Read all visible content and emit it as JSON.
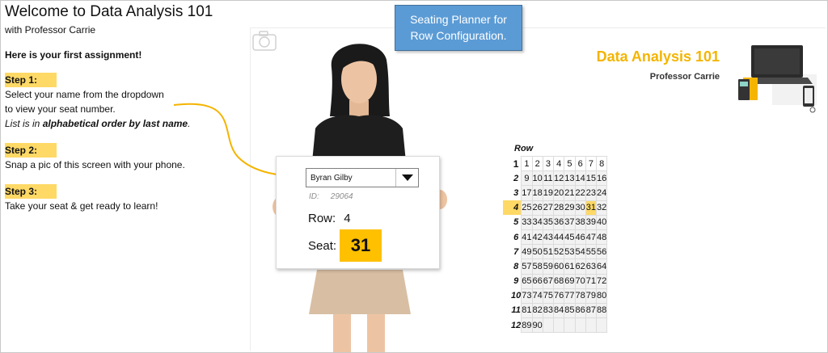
{
  "left": {
    "title": "Welcome to Data Analysis 101",
    "subtitle": "with Professor Carrie",
    "intro": "Here is your first assignment!",
    "steps": [
      {
        "label": "Step 1:",
        "lines": [
          "Select your name from the dropdown",
          "to view your seat number."
        ],
        "note_prefix": "List is in ",
        "note_bold": "alphabetical order by last name",
        "note_suffix": "."
      },
      {
        "label": "Step 2:",
        "lines": [
          "Snap a pic of this screen with your phone."
        ]
      },
      {
        "label": "Step 3:",
        "lines": [
          "Take your seat & get ready to learn!"
        ]
      }
    ]
  },
  "callout": {
    "line1": "Seating Planner for",
    "line2": "Row Configuration."
  },
  "brand": {
    "title": "Data Analysis 101",
    "subtitle": "Professor Carrie"
  },
  "sign": {
    "selected_student": "Byran Gilby",
    "id_label": "ID:",
    "id_value": "29064",
    "row_label": "Row:",
    "row_value": "4",
    "seat_label": "Seat:",
    "seat_value": "31"
  },
  "grid": {
    "row_header": "Row",
    "columns": [
      "1",
      "2",
      "3",
      "4",
      "5",
      "6",
      "7",
      "8"
    ],
    "rows": [
      {
        "row": "2",
        "seats": [
          "9",
          "10",
          "11",
          "12",
          "13",
          "14",
          "15",
          "16"
        ]
      },
      {
        "row": "3",
        "seats": [
          "17",
          "18",
          "19",
          "20",
          "21",
          "22",
          "23",
          "24"
        ]
      },
      {
        "row": "4",
        "seats": [
          "25",
          "26",
          "27",
          "28",
          "29",
          "30",
          "31",
          "32"
        ]
      },
      {
        "row": "5",
        "seats": [
          "33",
          "34",
          "35",
          "36",
          "37",
          "38",
          "39",
          "40"
        ]
      },
      {
        "row": "6",
        "seats": [
          "41",
          "42",
          "43",
          "44",
          "45",
          "46",
          "47",
          "48"
        ]
      },
      {
        "row": "7",
        "seats": [
          "49",
          "50",
          "51",
          "52",
          "53",
          "54",
          "55",
          "56"
        ]
      },
      {
        "row": "8",
        "seats": [
          "57",
          "58",
          "59",
          "60",
          "61",
          "62",
          "63",
          "64"
        ]
      },
      {
        "row": "9",
        "seats": [
          "65",
          "66",
          "67",
          "68",
          "69",
          "70",
          "71",
          "72"
        ]
      },
      {
        "row": "10",
        "seats": [
          "73",
          "74",
          "75",
          "76",
          "77",
          "78",
          "79",
          "80"
        ]
      },
      {
        "row": "11",
        "seats": [
          "81",
          "82",
          "83",
          "84",
          "85",
          "86",
          "87",
          "88"
        ]
      },
      {
        "row": "12",
        "seats": [
          "89",
          "90",
          "",
          "",
          "",
          "",
          "",
          ""
        ]
      }
    ],
    "first_row_label": "1",
    "highlight_row": "4",
    "highlight_seat": "31",
    "highlight_color": "#ffd966",
    "seat_color": "#ffc000"
  },
  "colors": {
    "brand": "#f4b400",
    "callout": "#5b9bd5",
    "step_highlight": "#ffd966"
  }
}
